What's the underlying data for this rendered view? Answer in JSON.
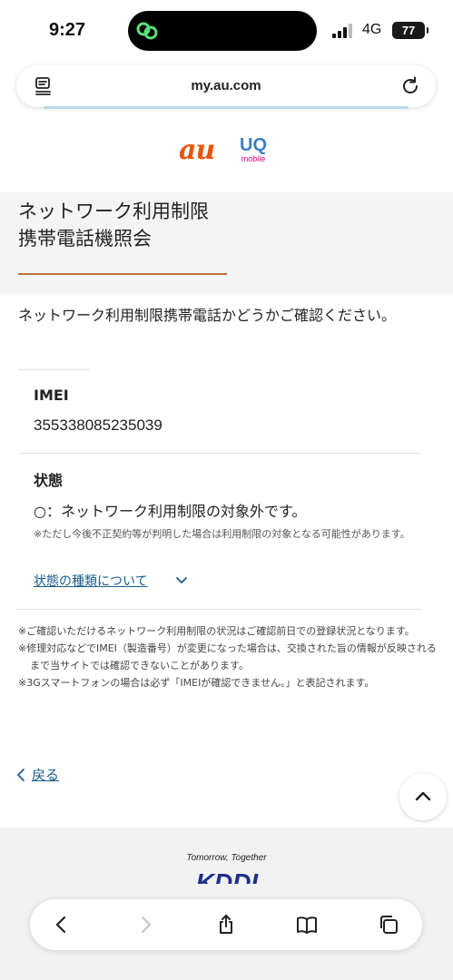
{
  "status_bar": {
    "time": "9:27",
    "network": "4G",
    "battery": "77"
  },
  "browser": {
    "url": "my.au.com"
  },
  "logos": {
    "au": "au",
    "uq_main": "UQ",
    "uq_sub": "mobile"
  },
  "page": {
    "title_line1": "ネットワーク利用制限",
    "title_line2": "携帯電話機照会",
    "intro": "ネットワーク利用制限携帯電話かどうかご確認ください。"
  },
  "result": {
    "imei_label": "IMEI",
    "imei_value": "355338085235039",
    "status_label": "状態",
    "status_value": "○：ネットワーク利用制限の対象外です。",
    "status_note": "※ただし今後不正契約等が判明した場合は利用制限の対象となる可能性があります。",
    "status_types_link": "状態の種類について"
  },
  "notes": [
    "※ご確認いただけるネットワーク利用制限の状況はご確認前日での登録状況となります。",
    "※修理対応などでIMEI（製造番号）が変更になった場合は、交換された旨の情報が反映されるまで当サイトでは確認できないことがあります。",
    "※3Gスマートフォンの場合は必ず「IMEIが確認できません。」と表記されます。"
  ],
  "nav": {
    "back_label": "戻る"
  },
  "footer": {
    "tagline": "Tomorrow, Together",
    "logo_text": "KDDI"
  },
  "colors": {
    "au_orange": "#eb5505",
    "uq_blue": "#3b7fc4",
    "link_blue": "#1a5c8e",
    "accent_underline": "#c0703a",
    "kddi_navy": "#1f2f8c"
  },
  "icons": {
    "app_indicator": "link-icon",
    "reader": "reader-icon",
    "reload": "reload-icon",
    "chevron_down": "chevron-down-icon",
    "back": "chevron-left-icon",
    "scroll_top": "chevron-up-icon",
    "toolbar_back": "chevron-left-icon",
    "toolbar_forward": "chevron-right-icon",
    "share": "share-icon",
    "bookmarks": "book-icon",
    "tabs": "tabs-icon"
  }
}
